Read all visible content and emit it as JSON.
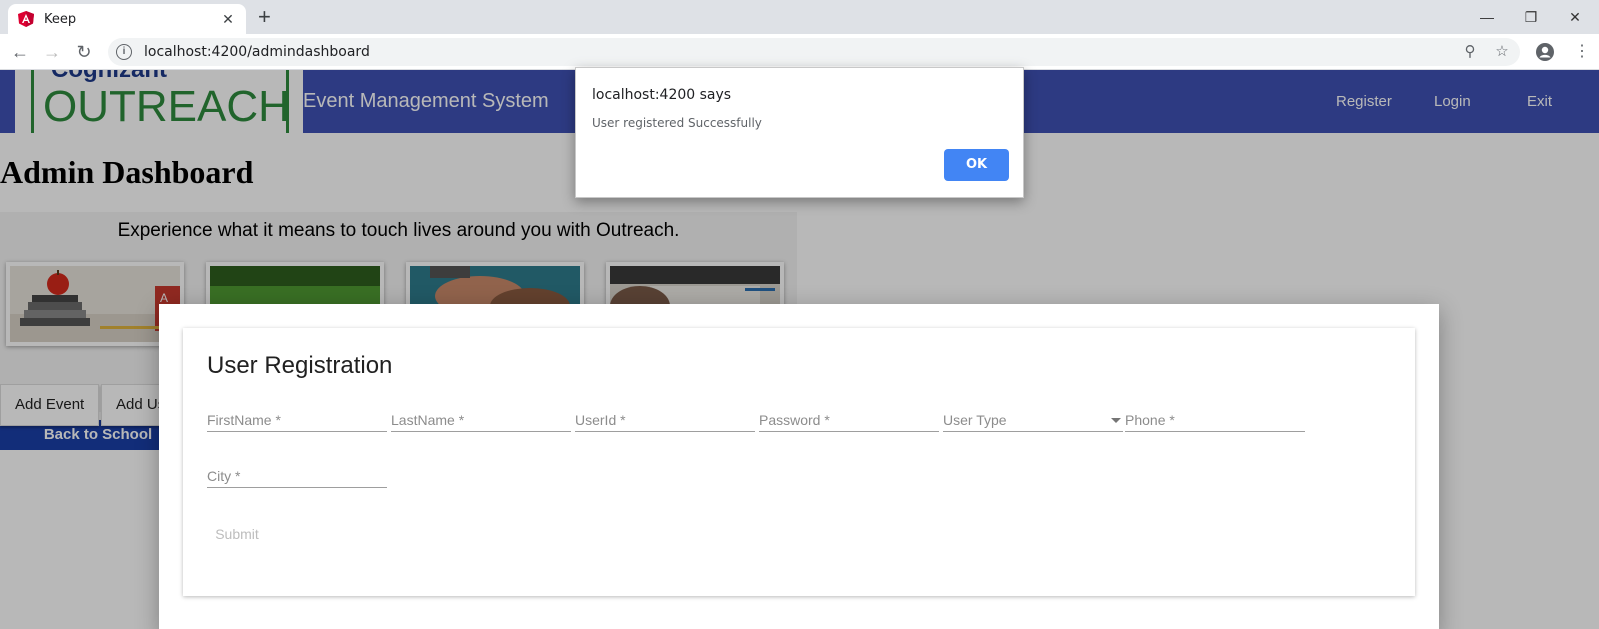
{
  "browser": {
    "tab_title": "Keep",
    "url": "localhost:4200/admindashboard",
    "icons": [
      "angular-favicon",
      "close-tab-icon",
      "new-tab-icon",
      "back-icon",
      "forward-icon",
      "reload-icon",
      "site-info-icon",
      "key-icon",
      "star-icon",
      "account-icon",
      "menu-icon",
      "minimize-icon",
      "restore-icon",
      "window-close-icon"
    ]
  },
  "navbar": {
    "logo_top": "Cognizant",
    "logo_main": "OUTREACH",
    "brand": "Event Management System",
    "links": [
      "Register",
      "Login",
      "Exit"
    ]
  },
  "page": {
    "title": "Admin Dashboard",
    "tagline": "Experience what it means to touch lives around you with Outreach.",
    "category_label": "Back to School",
    "buttons": [
      "Add Event",
      "Add Us"
    ]
  },
  "registration": {
    "title": "User Registration",
    "fields": {
      "firstname": "FirstName *",
      "lastname": "LastName *",
      "userid": "UserId *",
      "password": "Password *",
      "usertype": "User Type",
      "phone": "Phone *",
      "city": "City *"
    },
    "submit_label": "Submit"
  },
  "alert": {
    "title": "localhost:4200 says",
    "message": "User registered Successfully",
    "ok_label": "OK"
  },
  "colors": {
    "navbar": "#3f51b5",
    "category_label": "#1a3fa8",
    "ok_button": "#4285f4",
    "logo_green": "#2e8b3e"
  }
}
